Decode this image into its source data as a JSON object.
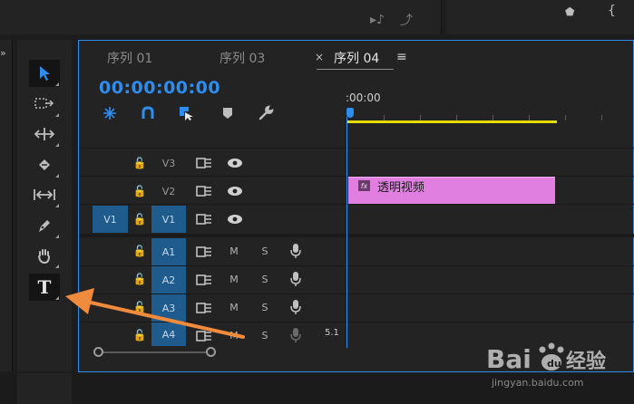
{
  "timeline": {
    "tabs": [
      {
        "label": "序列 01",
        "active": false
      },
      {
        "label": "序列 03",
        "active": false
      },
      {
        "label": "序列 04",
        "active": true
      }
    ],
    "close_glyph": "×",
    "menu_glyph": "≡",
    "timecode": "00:00:00:00",
    "ruler_start": ":00:00",
    "video_tracks": [
      {
        "name": "V3",
        "targeted": false,
        "lock": "🔓"
      },
      {
        "name": "V2",
        "targeted": false,
        "lock": "🔓"
      },
      {
        "name": "V1",
        "targeted": true,
        "lock": "🔓"
      }
    ],
    "source_patch": "V1",
    "audio_tracks": [
      {
        "name": "A1",
        "mute": "M",
        "solo": "S"
      },
      {
        "name": "A2",
        "mute": "M",
        "solo": "S"
      },
      {
        "name": "A3",
        "mute": "M",
        "solo": "S"
      },
      {
        "name": "A4",
        "mute": "M",
        "solo": "S"
      }
    ],
    "channel_label": "5.1",
    "clip": {
      "fx_badge": "fx",
      "name": "透明视频",
      "color": "#e07fe0"
    }
  },
  "tools": [
    {
      "name": "selection-tool",
      "icon": "arrow-icon",
      "active": true
    },
    {
      "name": "track-select-tool",
      "icon": "track-select-icon"
    },
    {
      "name": "ripple-edit-tool",
      "icon": "ripple-icon"
    },
    {
      "name": "razor-tool",
      "icon": "razor-icon"
    },
    {
      "name": "slip-tool",
      "icon": "slip-icon"
    },
    {
      "name": "pen-tool",
      "icon": "pen-icon"
    },
    {
      "name": "hand-tool",
      "icon": "hand-icon"
    },
    {
      "name": "type-tool",
      "icon": "type-icon",
      "glyph": "T"
    }
  ],
  "annotation": {
    "arrow_color": "#f08a3c"
  },
  "watermark": {
    "brand": "Bai du 经验",
    "url": "jingyan.baidu.com"
  },
  "colors": {
    "accent": "#2e8df0",
    "track_target": "#1f5c8d",
    "work_area": "#e6dc00"
  }
}
